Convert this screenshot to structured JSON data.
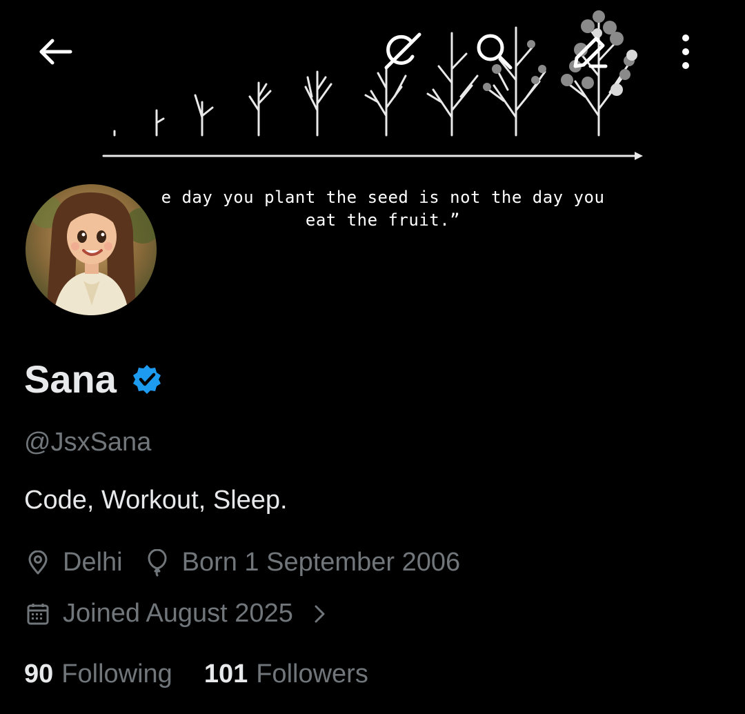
{
  "banner": {
    "quote_line1": "e day you plant the seed is not the day you",
    "quote_line2": "eat the fruit.”"
  },
  "toolbar": {
    "back_icon": "back-arrow-icon",
    "grok_icon": "grok-icon",
    "search_icon": "search-icon",
    "edit_icon": "edit-pencil-icon",
    "more_icon": "more-vertical-icon"
  },
  "profile": {
    "name": "Sana",
    "verified": true,
    "handle": "@JsxSana",
    "bio": "Code, Workout, Sleep.",
    "location": "Delhi",
    "birthday": "Born 1 September 2006",
    "joined": "Joined August 2025"
  },
  "stats": {
    "following_count": "90",
    "following_label": "Following",
    "followers_count": "101",
    "followers_label": "Followers"
  },
  "colors": {
    "background": "#000000",
    "primary_text": "#e7e9ea",
    "secondary_text": "#71767b",
    "verified_blue": "#1d9bf0"
  }
}
